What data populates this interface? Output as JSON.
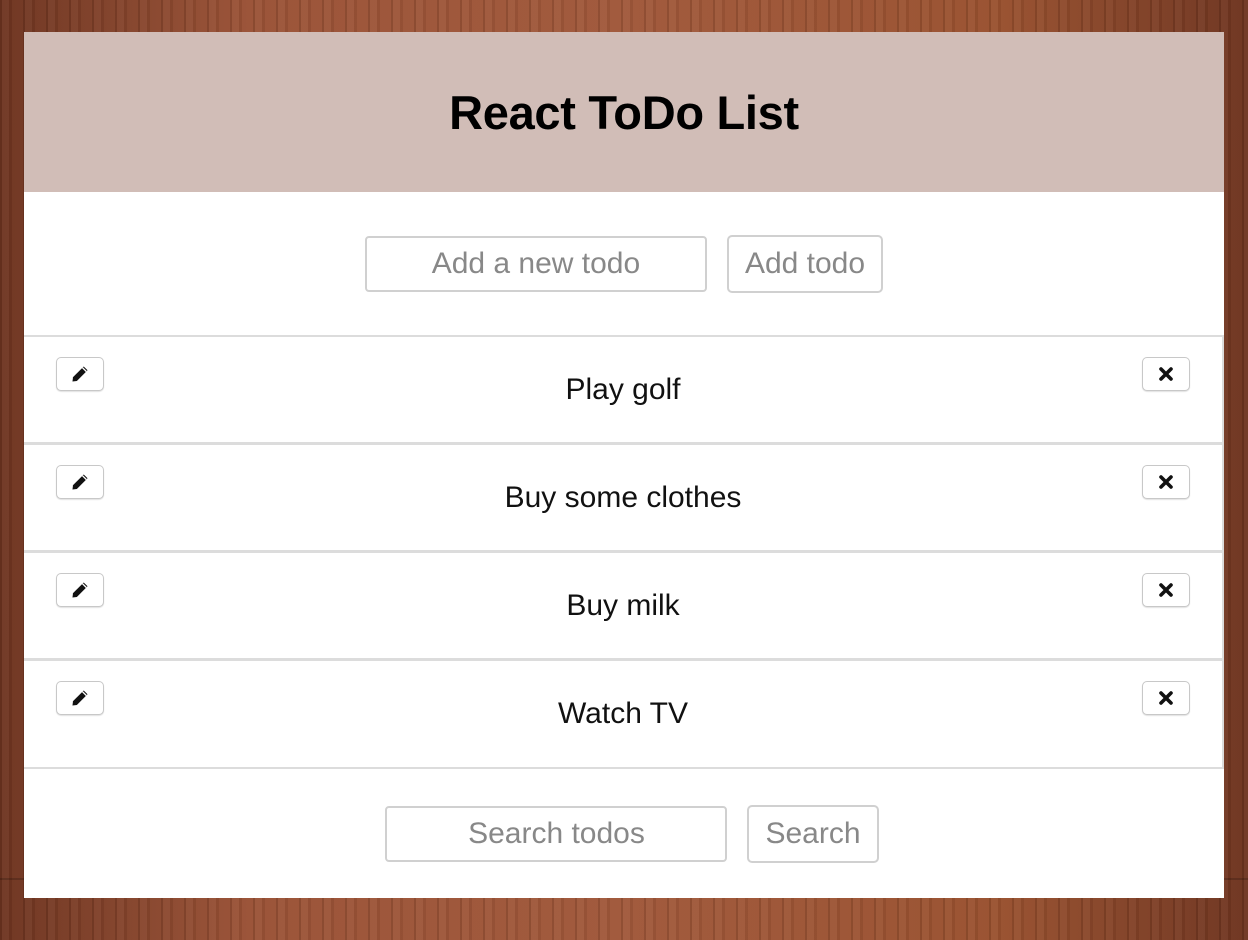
{
  "header": {
    "title": "React ToDo List"
  },
  "add_form": {
    "input_placeholder": "Add a new todo",
    "button_label": "Add todo"
  },
  "todos": [
    {
      "text": "Play golf"
    },
    {
      "text": "Buy some clothes"
    },
    {
      "text": "Buy milk"
    },
    {
      "text": "Watch TV"
    }
  ],
  "item_actions": {
    "edit_icon": "pencil-icon",
    "delete_icon": "close-icon"
  },
  "search_form": {
    "input_placeholder": "Search todos",
    "button_label": "Search"
  },
  "colors": {
    "header_bg": "#d1bdb7",
    "background_wood": "#8a4a30"
  }
}
